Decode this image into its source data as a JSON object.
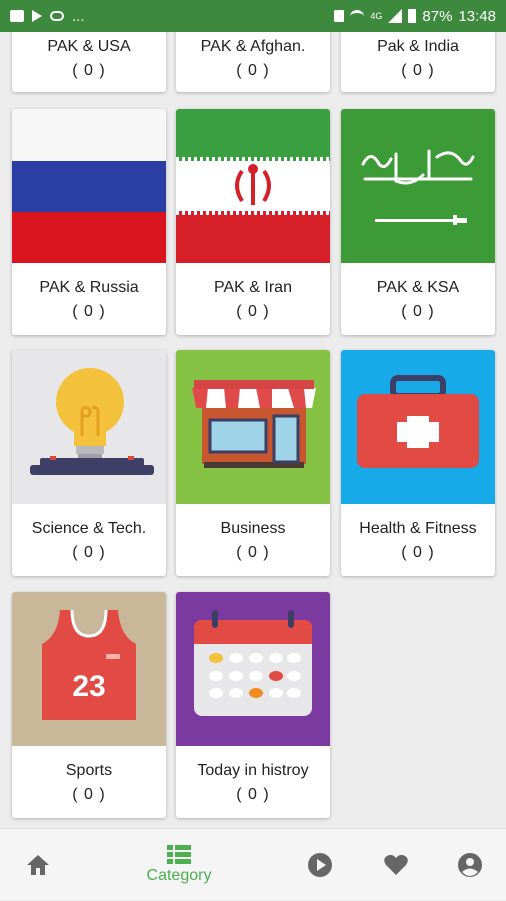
{
  "status_bar": {
    "battery": "87%",
    "time": "13:48",
    "network": "4G",
    "left_icons": [
      "image-icon",
      "flag-icon",
      "cloud-icon"
    ],
    "more": "..."
  },
  "cards": [
    {
      "title": "PAK & USA",
      "count": "( 0 )",
      "icon": "usa-flag"
    },
    {
      "title": "PAK & Afghan.",
      "count": "( 0 )",
      "icon": "afghanistan-flag"
    },
    {
      "title": "Pak & India",
      "count": "( 0 )",
      "icon": "india-flag"
    },
    {
      "title": "PAK & Russia",
      "count": "( 0 )",
      "icon": "russia-flag"
    },
    {
      "title": "PAK & Iran",
      "count": "( 0 )",
      "icon": "iran-flag"
    },
    {
      "title": "PAK & KSA",
      "count": "( 0 )",
      "icon": "saudi-flag"
    },
    {
      "title": "Science & Tech.",
      "count": "( 0 )",
      "icon": "lightbulb-icon"
    },
    {
      "title": "Business",
      "count": "( 0 )",
      "icon": "shop-icon"
    },
    {
      "title": "Health & Fitness",
      "count": "( 0 )",
      "icon": "first-aid-icon"
    },
    {
      "title": "Sports",
      "count": "( 0 )",
      "icon": "jersey-icon"
    },
    {
      "title": "Today in histroy",
      "count": "( 0 )",
      "icon": "calendar-icon"
    }
  ],
  "jersey_number": "23",
  "bottom_nav": {
    "active_label": "Category",
    "items": [
      "home-icon",
      "category-icon",
      "play-icon",
      "heart-icon",
      "account-icon"
    ]
  },
  "colors": {
    "status_bar": "#3d8a3e",
    "accent": "#4caf50",
    "russia_white": "#f7f7f7",
    "russia_blue": "#2b3ea3",
    "russia_red": "#d8141f",
    "iran_green": "#3a9f40",
    "iran_red": "#d5202a",
    "saudi_green": "#3c9a37",
    "science_bg": "#e7e7e9",
    "business_bg": "#85c244",
    "health_bg": "#17a9e8",
    "sports_bg": "#c9b79a",
    "history_bg": "#7b3aa0"
  }
}
